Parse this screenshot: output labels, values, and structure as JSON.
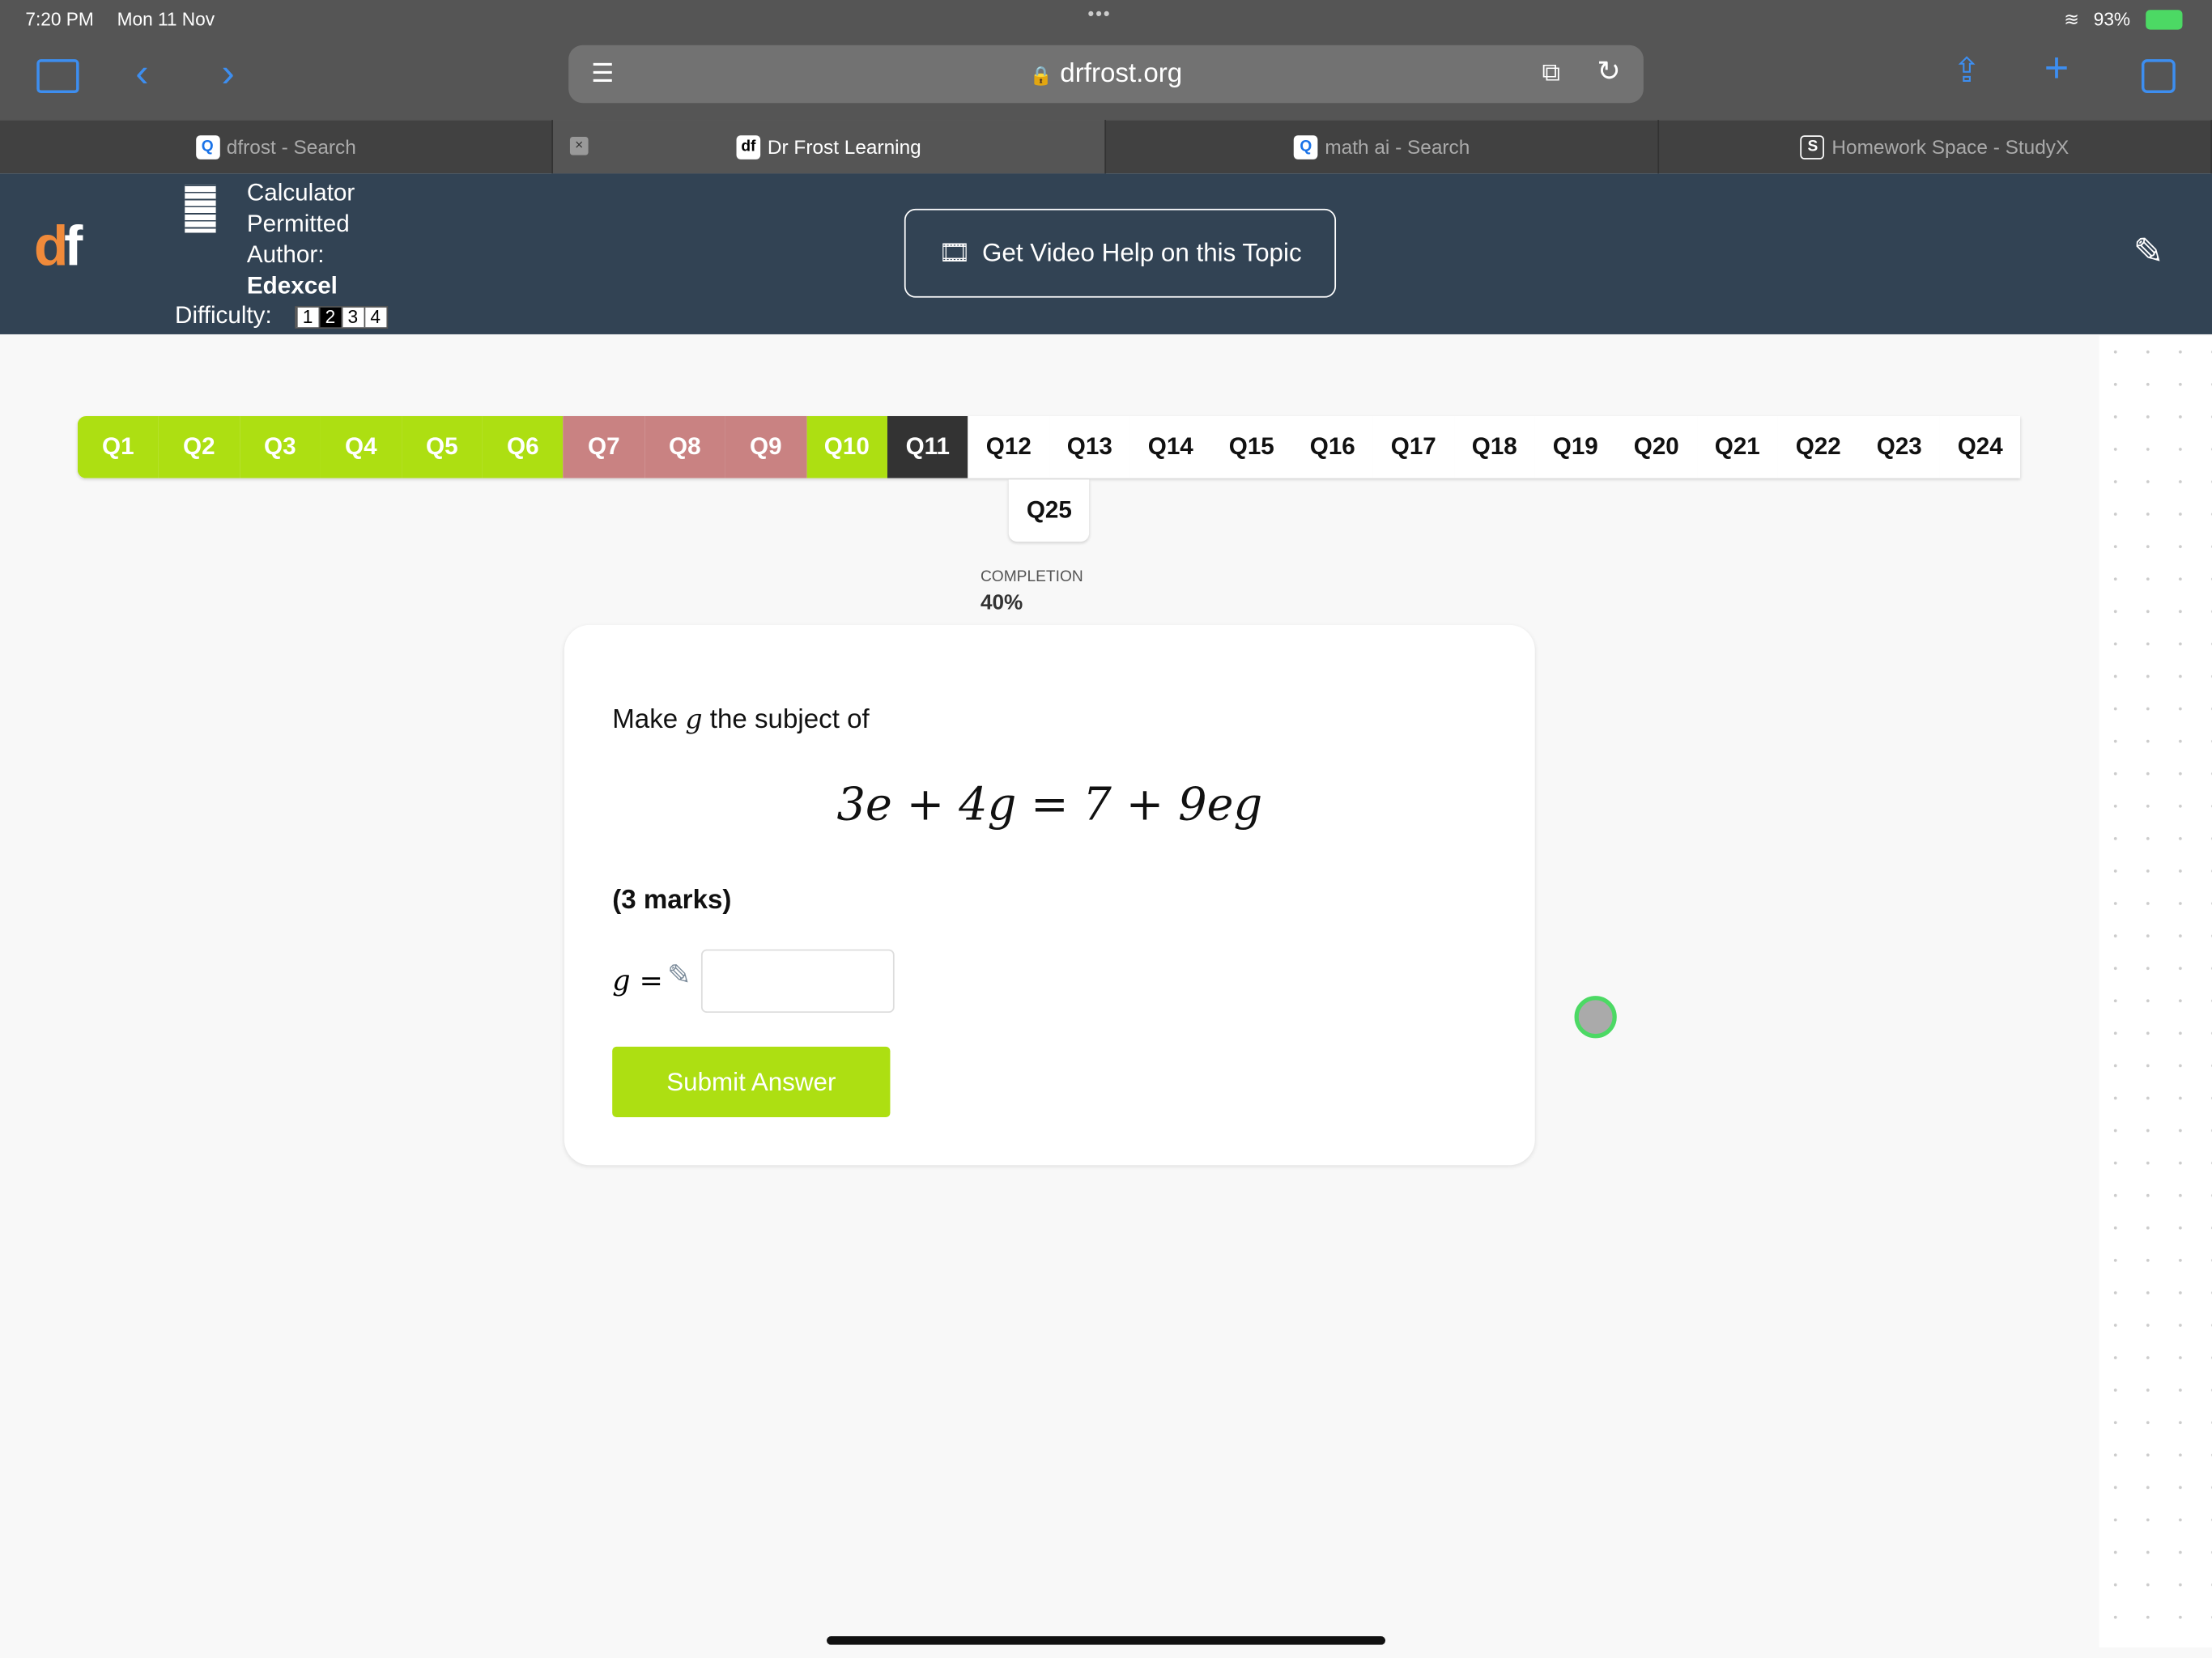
{
  "status_bar": {
    "time": "7:20 PM",
    "date": "Mon 11 Nov",
    "battery": "93%"
  },
  "browser": {
    "url": "drfrost.org",
    "tabs": [
      {
        "label": "dfrost - Search",
        "icon": "search-icon"
      },
      {
        "label": "Dr Frost Learning",
        "icon": "df-icon",
        "active": true
      },
      {
        "label": "math ai - Search",
        "icon": "search-icon"
      },
      {
        "label": "Homework Space - StudyX",
        "icon": "s-icon"
      }
    ]
  },
  "header": {
    "calculator_line1": "Calculator",
    "calculator_line2": "Permitted",
    "author_label": "Author:",
    "author": "Edexcel",
    "difficulty_label": "Difficulty:",
    "difficulty_levels": [
      "1",
      "2",
      "3",
      "4"
    ],
    "difficulty_selected": 2,
    "video_help": "Get Video Help on this Topic"
  },
  "questions": {
    "items": [
      {
        "label": "Q1",
        "status": "correct"
      },
      {
        "label": "Q2",
        "status": "correct"
      },
      {
        "label": "Q3",
        "status": "correct"
      },
      {
        "label": "Q4",
        "status": "correct"
      },
      {
        "label": "Q5",
        "status": "correct"
      },
      {
        "label": "Q6",
        "status": "correct"
      },
      {
        "label": "Q7",
        "status": "incorrect"
      },
      {
        "label": "Q8",
        "status": "incorrect"
      },
      {
        "label": "Q9",
        "status": "incorrect"
      },
      {
        "label": "Q10",
        "status": "correct"
      },
      {
        "label": "Q11",
        "status": "current"
      },
      {
        "label": "Q12"
      },
      {
        "label": "Q13"
      },
      {
        "label": "Q14"
      },
      {
        "label": "Q15"
      },
      {
        "label": "Q16"
      },
      {
        "label": "Q17"
      },
      {
        "label": "Q18"
      },
      {
        "label": "Q19"
      },
      {
        "label": "Q20"
      },
      {
        "label": "Q21"
      },
      {
        "label": "Q22"
      },
      {
        "label": "Q23"
      },
      {
        "label": "Q24"
      },
      {
        "label": "Q25"
      }
    ],
    "colors": {
      "correct": "#addf12",
      "incorrect": "#c98282",
      "current": "#333333"
    }
  },
  "completion": {
    "label": "COMPLETION",
    "value": "40%"
  },
  "question": {
    "prompt_pre": "Make",
    "prompt_var": "g",
    "prompt_post": "the subject of",
    "equation": "3e + 4g = 7 + 9eg",
    "marks": "(3 marks)",
    "answer_label": "g =",
    "answer_value": "",
    "submit": "Submit Answer"
  }
}
